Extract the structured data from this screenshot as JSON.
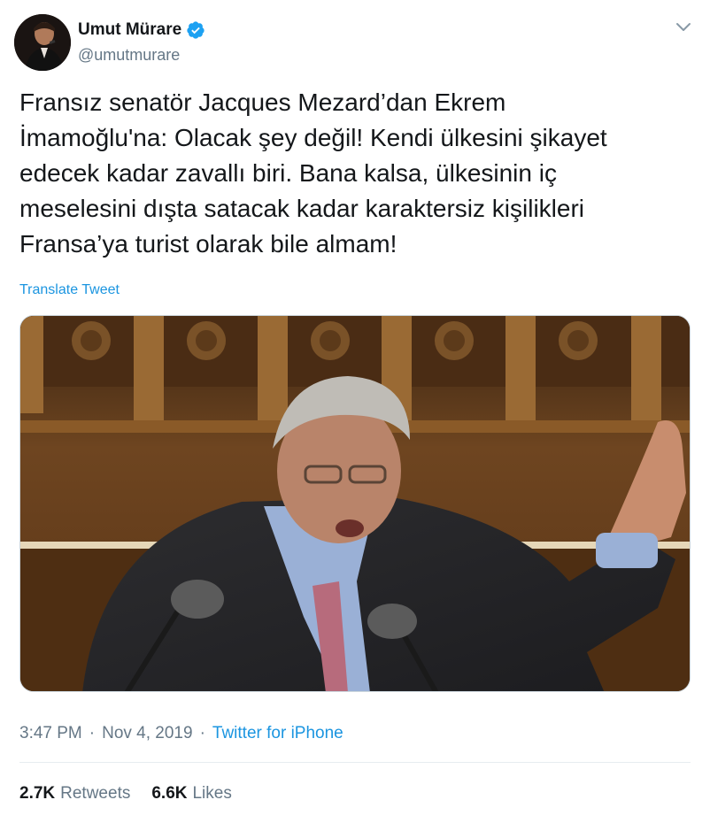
{
  "author": {
    "display_name": "Umut Mürare",
    "handle": "@umutmurare",
    "verified_icon": "verified-badge-icon",
    "accent_color": "#1da1f2"
  },
  "tweet": {
    "text": "Fransız senatör Jacques Mezard’dan Ekrem\nİmamoğlu'na: Olacak şey değil! Kendi ülkesini şikayet\nedecek kadar zavallı biri. Bana kalsa, ülkesinin iç\nmeselesini dışta satacak kadar karaktersiz kişilikleri\nFransa’ya turist olarak bile almam!",
    "translate_label": "Translate Tweet",
    "time": "3:47 PM",
    "separator": "·",
    "date": "Nov 4, 2019",
    "source": "Twitter for iPhone"
  },
  "stats": {
    "retweets_count": "2.7K",
    "retweets_label": "Retweets",
    "likes_count": "6.6K",
    "likes_label": "Likes"
  },
  "colors": {
    "link": "#1b95e0",
    "secondary_text": "#657786",
    "primary_text": "#14171a"
  }
}
